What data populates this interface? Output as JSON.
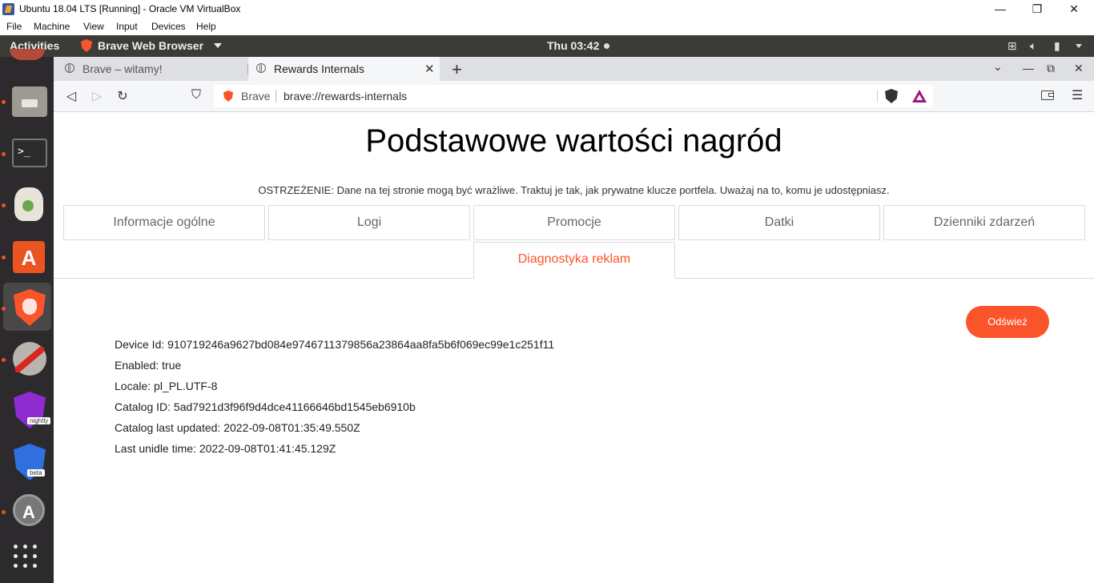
{
  "vbox": {
    "title": "Ubuntu 18.04 LTS [Running] - Oracle VM VirtualBox",
    "menu": [
      "File",
      "Machine",
      "View",
      "Input",
      "Devices",
      "Help"
    ]
  },
  "ubuntu": {
    "activities": "Activities",
    "app_name": "Brave Web Browser",
    "clock": "Thu 03:42"
  },
  "browser": {
    "tabs": [
      {
        "title": "Brave – witamy!",
        "active": false
      },
      {
        "title": "Rewards Internals",
        "active": true
      }
    ],
    "omnibox": {
      "site": "Brave",
      "url": "brave://rewards-internals"
    }
  },
  "page": {
    "title": "Podstawowe wartości nagród",
    "warning": "OSTRZEŻENIE: Dane na tej stronie mogą być wrażliwe. Traktuj je tak, jak prywatne klucze portfela. Uważaj na to, komu je udostępniasz.",
    "tabs": [
      "Informacje ogólne",
      "Logi",
      "Promocje",
      "Datki",
      "Dzienniki zdarzeń",
      "Diagnostyka reklam"
    ],
    "active_tab": "Diagnostyka reklam",
    "refresh_label": "Odśwież",
    "fields": [
      {
        "label": "Device Id",
        "value": "910719246a9627bd084e9746711379856a23864aa8fa5b6f069ec99e1c251f11"
      },
      {
        "label": "Enabled",
        "value": "true"
      },
      {
        "label": "Locale",
        "value": "pl_PL.UTF-8"
      },
      {
        "label": "Catalog ID",
        "value": "5ad7921d3f96f9d4dce41166646bd1545eb6910b"
      },
      {
        "label": "Catalog last updated",
        "value": "2022-09-08T01:35:49.550Z"
      },
      {
        "label": "Last unidle time",
        "value": "2022-09-08T01:41:45.129Z"
      }
    ],
    "lines": [
      "Device Id: 910719246a9627bd084e9746711379856a23864aa8fa5b6f069ec99e1c251f11",
      "Enabled: true",
      "Locale: pl_PL.UTF-8",
      "Catalog ID: 5ad7921d3f96f9d4dce41166646bd1545eb6910b",
      "Catalog last updated: 2022-09-08T01:35:49.550Z",
      "Last unidle time: 2022-09-08T01:41:45.129Z"
    ]
  },
  "colors": {
    "accent": "#fb542b",
    "ubuntu_bar": "#3c3b37",
    "dock": "#2d2a2e"
  }
}
